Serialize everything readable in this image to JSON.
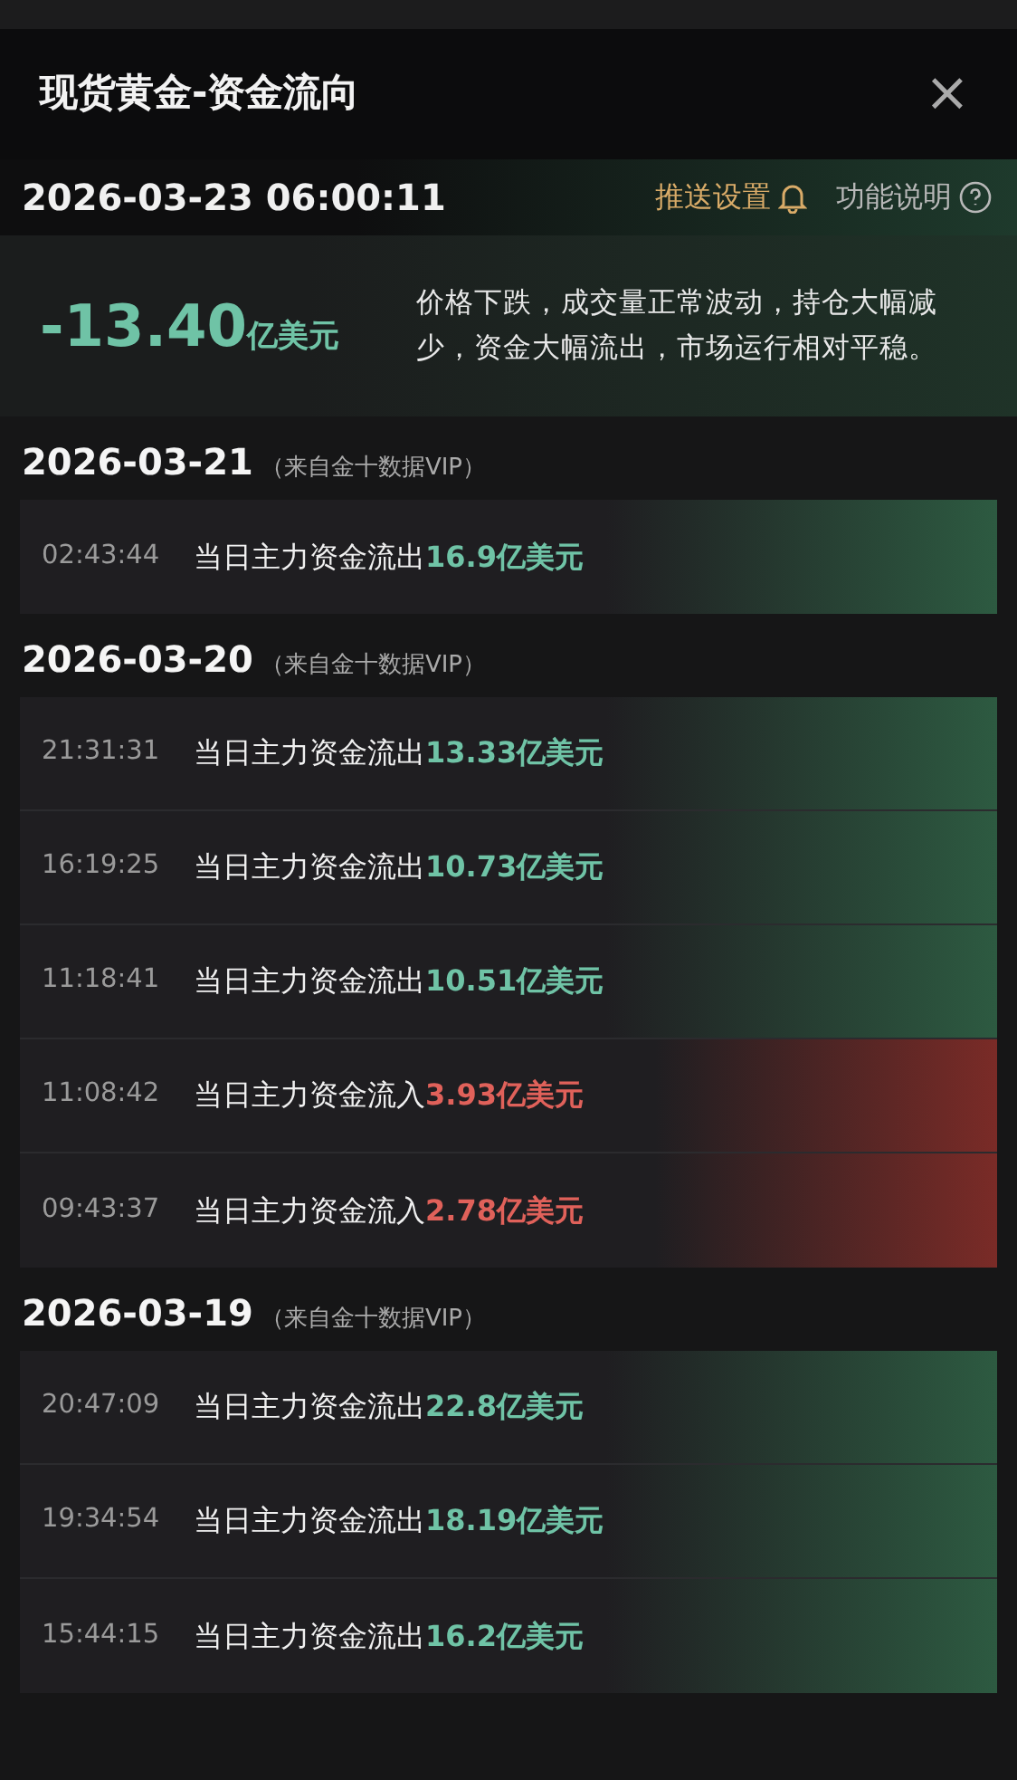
{
  "header": {
    "title": "现货黄金-资金流向",
    "close": "×"
  },
  "summary": {
    "datetime": "2026-03-23 06:00:11",
    "push_settings": "推送设置",
    "help": "功能说明",
    "amount": "-13.40",
    "unit": "亿美元",
    "description": "价格下跌，成交量正常波动，持仓大幅减少，资金大幅流出，市场运行相对平稳。"
  },
  "groups": [
    {
      "date": "2026-03-21",
      "source": "（来自金十数据VIP）",
      "rows": [
        {
          "time": "02:43:44",
          "label": "当日主力资金流出",
          "amount": "16.9亿美元",
          "kind": "outflow"
        }
      ]
    },
    {
      "date": "2026-03-20",
      "source": "（来自金十数据VIP）",
      "rows": [
        {
          "time": "21:31:31",
          "label": "当日主力资金流出",
          "amount": "13.33亿美元",
          "kind": "outflow"
        },
        {
          "time": "16:19:25",
          "label": "当日主力资金流出",
          "amount": "10.73亿美元",
          "kind": "outflow"
        },
        {
          "time": "11:18:41",
          "label": "当日主力资金流出",
          "amount": "10.51亿美元",
          "kind": "outflow"
        },
        {
          "time": "11:08:42",
          "label": "当日主力资金流入",
          "amount": "3.93亿美元",
          "kind": "inflow"
        },
        {
          "time": "09:43:37",
          "label": "当日主力资金流入",
          "amount": "2.78亿美元",
          "kind": "inflow"
        }
      ]
    },
    {
      "date": "2026-03-19",
      "source": "（来自金十数据VIP）",
      "rows": [
        {
          "time": "20:47:09",
          "label": "当日主力资金流出",
          "amount": "22.8亿美元",
          "kind": "outflow"
        },
        {
          "time": "19:34:54",
          "label": "当日主力资金流出",
          "amount": "18.19亿美元",
          "kind": "outflow"
        },
        {
          "time": "15:44:15",
          "label": "当日主力资金流出",
          "amount": "16.2亿美元",
          "kind": "outflow"
        }
      ]
    }
  ]
}
